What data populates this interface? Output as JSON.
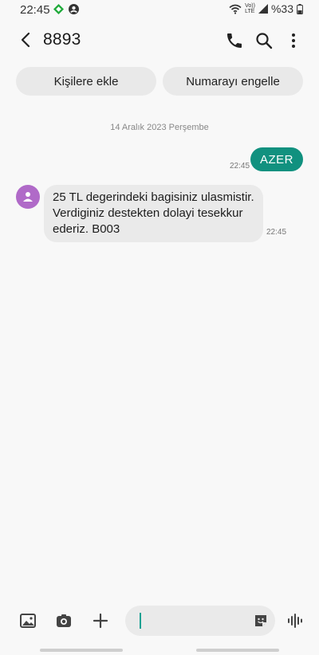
{
  "status_bar": {
    "time": "22:45",
    "battery_percent": "%33",
    "volte_label": "Vo))",
    "lte_label": "LTE"
  },
  "header": {
    "title": "8893"
  },
  "actions": {
    "add_contact_label": "Kişilere ekle",
    "block_number_label": "Numarayı engelle"
  },
  "conversation": {
    "date_separator": "14 Aralık 2023 Perşembe",
    "sent_message": {
      "text": "AZER",
      "time": "22:45"
    },
    "received_message": {
      "text": "25 TL degerindeki bagisiniz ulasmistir. Verdiginiz destekten dolayi tesekkur ederiz. B003",
      "time": "22:45"
    }
  },
  "composer": {
    "placeholder": "",
    "value": ""
  },
  "colors": {
    "accent": "#11917f",
    "avatar": "#b06ac8",
    "bubble_received": "#eaeaea",
    "background": "#f8f8f8"
  },
  "icons": [
    "back-arrow-icon",
    "phone-icon",
    "search-icon",
    "more-options-icon",
    "image-icon",
    "camera-icon",
    "plus-icon",
    "sticker-icon",
    "voice-icon",
    "contact-avatar-icon",
    "wifi-icon",
    "signal-icon",
    "battery-icon"
  ]
}
